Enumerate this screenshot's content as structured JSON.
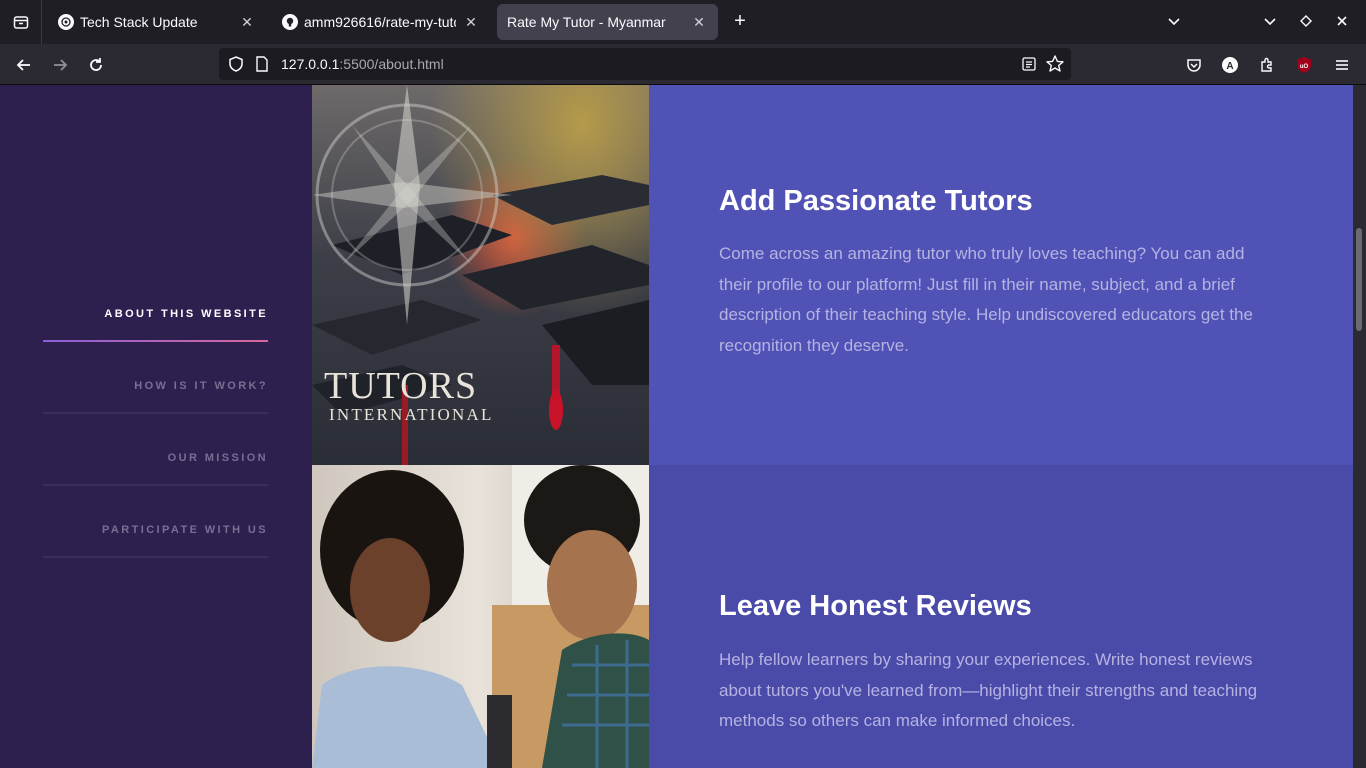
{
  "browser": {
    "tabs": [
      {
        "title": "Tech Stack Update"
      },
      {
        "title": "amm926616/rate-my-tutor"
      },
      {
        "title": "Rate My Tutor - Myanmar"
      }
    ],
    "url_host": "127.0.0.1",
    "url_rest": ":5500/about.html"
  },
  "sidebar": {
    "items": [
      {
        "label": "ABOUT THIS WEBSITE"
      },
      {
        "label": "HOW IS IT WORK?"
      },
      {
        "label": "OUR MISSION"
      },
      {
        "label": "PARTICIPATE WITH US"
      }
    ]
  },
  "sections": [
    {
      "heading": "Add Passionate Tutors",
      "body": "Come across an amazing tutor who truly loves teaching? You can add their profile to our platform! Just fill in their name, subject, and a brief description of their teaching style. Help undiscovered educators get the recognition they deserve.",
      "image_brand": "TUTORS",
      "image_brand_sub": "INTERNATIONAL"
    },
    {
      "heading": "Leave Honest Reviews",
      "body": "Help fellow learners by sharing your experiences. Write honest reviews about tutors you've learned from—highlight their strengths and teaching methods so others can make informed choices."
    }
  ],
  "colors": {
    "sidebar_bg": "#2d1f4e",
    "panel1_bg": "#5152b5",
    "panel2_bg": "#4a4aa9",
    "accent_gradient_start": "#8b5fd6",
    "accent_gradient_end": "#d7689b"
  }
}
